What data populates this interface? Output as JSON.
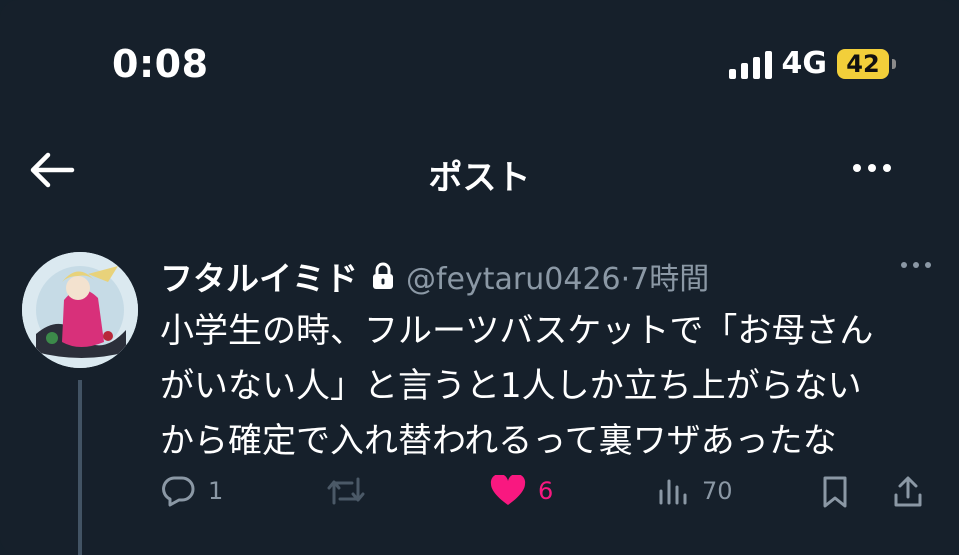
{
  "status_bar": {
    "time": "0:08",
    "network": "4G",
    "battery_level": "42",
    "battery_color": "#f2cf3a"
  },
  "header": {
    "title": "ポスト"
  },
  "post": {
    "author_name": "フタルイミド",
    "handle_meta": "@feytaru0426·7時間",
    "text_lines": [
      "小学生の時、フルーツバスケットで「お母さん",
      "がいない人」と言うと1人しか立ち上がらない",
      "から確定で入れ替われるって裏ワザあったな"
    ],
    "replies": "1",
    "reposts": "",
    "likes": "6",
    "views": "70",
    "like_color": "#f91880"
  },
  "theme": {
    "background": "#16202b",
    "muted_text": "#8b98a5"
  }
}
